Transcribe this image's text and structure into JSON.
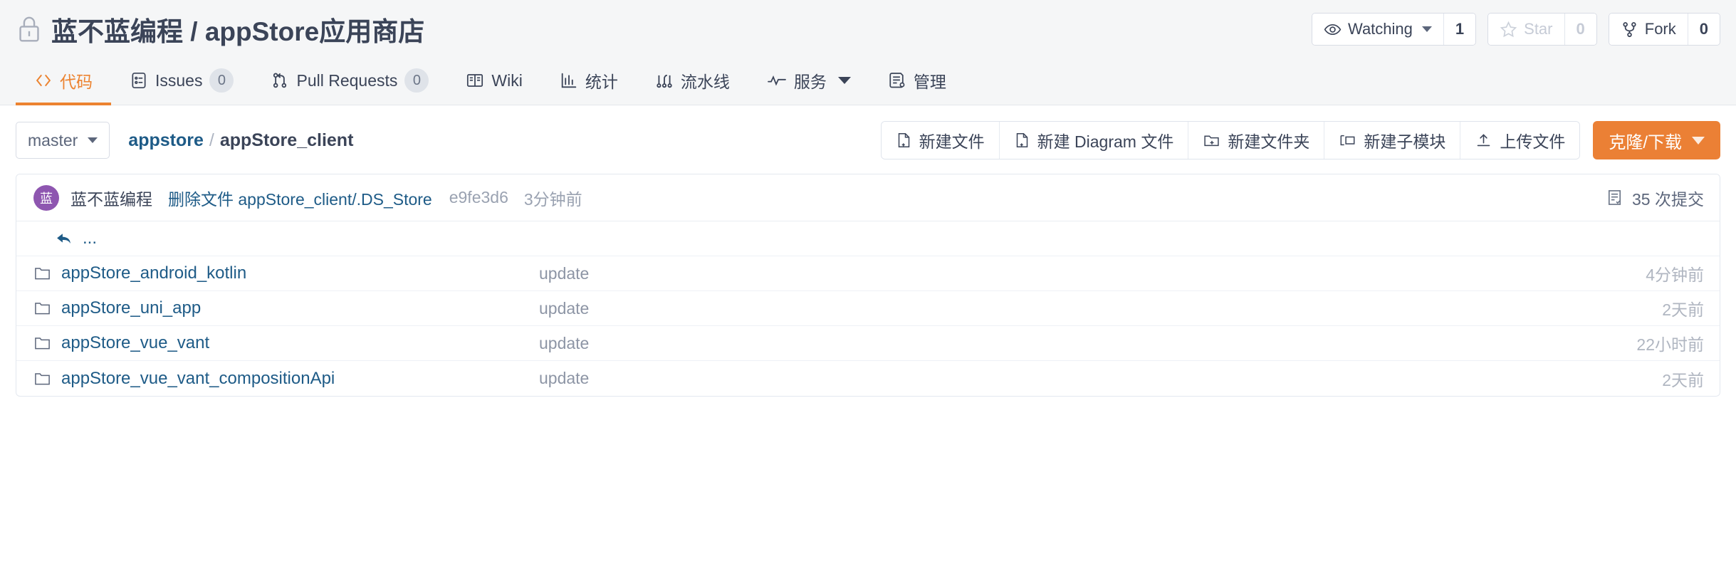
{
  "header": {
    "lock_icon": "lock-icon",
    "owner": "蓝不蓝编程",
    "separator": "/",
    "repo": "appStore应用商店",
    "title": "蓝不蓝编程 / appStore应用商店",
    "watch": {
      "icon": "eye-icon",
      "label": "Watching",
      "count": "1"
    },
    "star": {
      "icon": "star-icon",
      "label": "Star",
      "count": "0"
    },
    "fork": {
      "icon": "fork-icon",
      "label": "Fork",
      "count": "0"
    }
  },
  "nav": {
    "tabs": [
      {
        "label": "代码",
        "icon": "code-brackets-icon",
        "active": true,
        "badge": null
      },
      {
        "label": "Issues",
        "icon": "issue-list-icon",
        "active": false,
        "badge": "0"
      },
      {
        "label": "Pull Requests",
        "icon": "pull-request-icon",
        "active": false,
        "badge": "0"
      },
      {
        "label": "Wiki",
        "icon": "book-icon",
        "active": false,
        "badge": null
      },
      {
        "label": "统计",
        "icon": "bar-chart-icon",
        "active": false,
        "badge": null
      },
      {
        "label": "流水线",
        "icon": "pipeline-icon",
        "active": false,
        "badge": null
      },
      {
        "label": "服务",
        "icon": "activity-icon",
        "active": false,
        "badge": null,
        "has_caret": true
      },
      {
        "label": "管理",
        "icon": "manage-doc-icon",
        "active": false,
        "badge": null
      }
    ]
  },
  "toolbar": {
    "branch": "master",
    "breadcrumb": {
      "root": "appstore",
      "sep": "/",
      "current": "appStore_client"
    },
    "buttons": [
      {
        "label": "新建文件",
        "icon": "new-file-icon"
      },
      {
        "label": "新建 Diagram 文件",
        "icon": "new-diagram-file-icon"
      },
      {
        "label": "新建文件夹",
        "icon": "new-folder-icon"
      },
      {
        "label": "新建子模块",
        "icon": "new-submodule-icon"
      },
      {
        "label": "上传文件",
        "icon": "upload-icon"
      }
    ],
    "clone": {
      "label": "克隆/下载",
      "color": "#eb8035"
    }
  },
  "commit_bar": {
    "avatar_initial": "蓝",
    "avatar_color": "#8e56b0",
    "author": "蓝不蓝编程",
    "message": "删除文件 appStore_client/.DS_Store",
    "hash": "e9fe3d6",
    "time": "3分钟前",
    "commit_count_label": "35 次提交",
    "commit_count_icon": "commit-history-icon"
  },
  "file_list": {
    "parent_row": {
      "label": "...",
      "icon": "back-arrow-icon"
    },
    "rows": [
      {
        "icon": "folder-icon",
        "name": "appStore_android_kotlin",
        "message": "update",
        "time": "4分钟前"
      },
      {
        "icon": "folder-icon",
        "name": "appStore_uni_app",
        "message": "update",
        "time": "2天前"
      },
      {
        "icon": "folder-icon",
        "name": "appStore_vue_vant",
        "message": "update",
        "time": "22小时前"
      },
      {
        "icon": "folder-icon",
        "name": "appStore_vue_vant_compositionApi",
        "message": "update",
        "time": "2天前"
      }
    ]
  },
  "colors": {
    "accent": "#eb8035",
    "link": "#1e5b87",
    "text": "#3b4458",
    "muted": "#9aa2b1",
    "header_bg": "#f5f6f7"
  }
}
